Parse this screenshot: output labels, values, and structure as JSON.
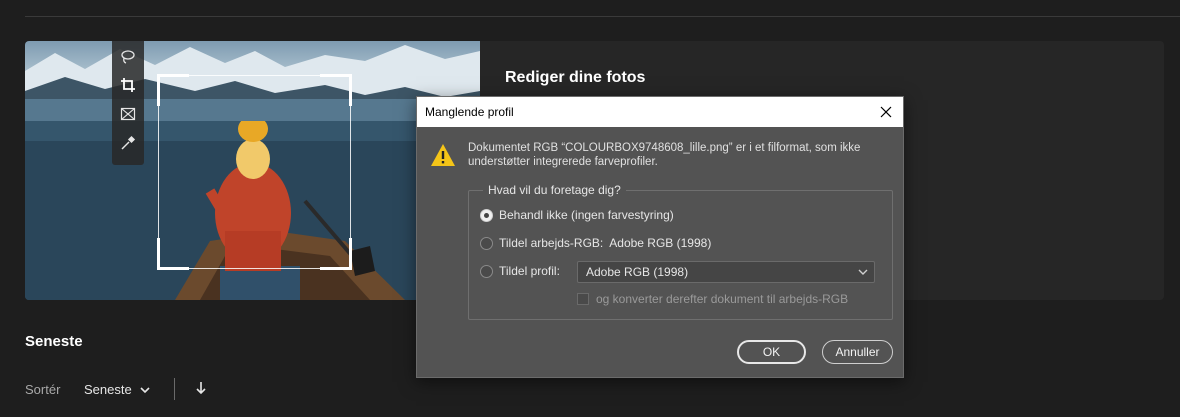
{
  "hero": {
    "title": "Rediger dine fotos"
  },
  "toolbar": {
    "tools": [
      "lasso-icon",
      "crop-icon",
      "frame-icon",
      "eyedropper-icon"
    ]
  },
  "recent": {
    "title": "Seneste",
    "sort_label": "Sortér",
    "sort_value": "Seneste"
  },
  "dialog": {
    "title": "Manglende profil",
    "message": "Dokumentet RGB “COLOURBOX9748608_lille.png” er i et filformat, som ikke understøtter integrerede farveprofiler.",
    "group_label": "Hvad vil du foretage dig?",
    "options": [
      {
        "label": "Behandl ikke (ingen farvestyring)",
        "selected": true
      },
      {
        "label": "Tildel arbejds-RGB:  Adobe RGB (1998)",
        "selected": false
      },
      {
        "label": "Tildel profil:",
        "selected": false
      }
    ],
    "profile_value": "Adobe RGB (1998)",
    "convert_label": "og konverter derefter dokument til arbejds-RGB",
    "ok_label": "OK",
    "cancel_label": "Annuller"
  },
  "colors": {
    "background": "#1e1e1e",
    "dialog": "#535353",
    "warning": "#f5c518"
  }
}
